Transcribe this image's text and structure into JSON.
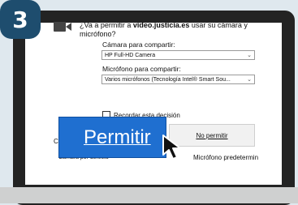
{
  "step_number": "3",
  "prompt": {
    "text_before": "¿Va a permitir a ",
    "site": "video.justicia.es",
    "text_after": " usar su cámara y micrófono?"
  },
  "camera_label": "Cámara para compartir:",
  "camera_value": "HP Full-HD Camera",
  "mic_label": "Micrófono para compartir:",
  "mic_value": "Varios micrófonos (Tecnología Intel® Smart Sou...",
  "remember_label": "Recordar esta decisión",
  "allow_button": "Permitir",
  "deny_button": "No permitir",
  "bg_fragment_left": "C",
  "bg_fragment_bottom_left": "Cámara por defecto",
  "bg_fragment_bottom_right": "Micrófono predetermin",
  "icons": {
    "camera": "video-camera-icon",
    "cursor": "mouse-pointer-icon",
    "dropdown": "chevron-down-icon"
  },
  "colors": {
    "step_badge": "#1e4d6e",
    "allow_bg": "#1f6fd0",
    "frame": "#232323"
  }
}
